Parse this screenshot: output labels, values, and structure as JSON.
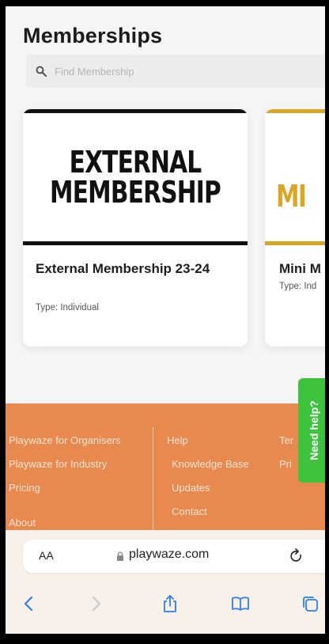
{
  "header": {
    "title": "Memberships",
    "search_placeholder": "Find Membership"
  },
  "memberships": [
    {
      "banner_line1": "EXTERNAL",
      "banner_line2": "MEMBERSHIP",
      "name": "External Membership 23-24",
      "type": "Type: Individual"
    },
    {
      "banner_text": "MI",
      "name": "Mini M",
      "type": "Type: Ind"
    }
  ],
  "footer": {
    "column1": [
      "Playwaze for Organisers",
      "Playwaze for Industry",
      "Pricing",
      "About"
    ],
    "column2_heading": "Help",
    "column2": [
      "Knowledge Base",
      "Updates",
      "Contact"
    ],
    "column3": [
      "Ter",
      "Pri"
    ]
  },
  "help_tab": {
    "label": "Need help?"
  },
  "browser": {
    "text_size_label": "AA",
    "url": "playwaze.com"
  },
  "colors": {
    "footer": "#e88a4f",
    "help": "#3cc23c",
    "gold": "#d9a625"
  }
}
